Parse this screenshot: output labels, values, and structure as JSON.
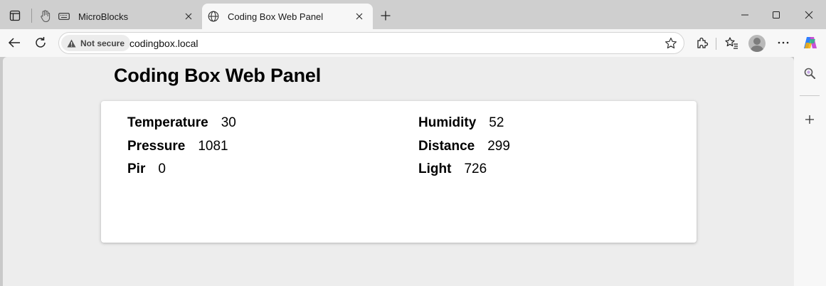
{
  "browser": {
    "tabs": [
      {
        "title": "MicroBlocks",
        "icon": "keyboard-icon",
        "active": false
      },
      {
        "title": "Coding Box Web Panel",
        "icon": "globe-icon",
        "active": true
      }
    ],
    "security_label": "Not secure",
    "url": "codingbox.local"
  },
  "page": {
    "title": "Coding Box Web Panel",
    "sensors": [
      {
        "label": "Temperature",
        "value": "30"
      },
      {
        "label": "Humidity",
        "value": "52"
      },
      {
        "label": "Pressure",
        "value": "1081"
      },
      {
        "label": "Distance",
        "value": "299"
      },
      {
        "label": "Pir",
        "value": "0"
      },
      {
        "label": "Light",
        "value": "726"
      }
    ]
  },
  "colors": {
    "tabstrip": "#cfcfcf",
    "toolbar": "#f7f7f7",
    "page_background": "#ededed",
    "panel_background": "#ffffff"
  }
}
